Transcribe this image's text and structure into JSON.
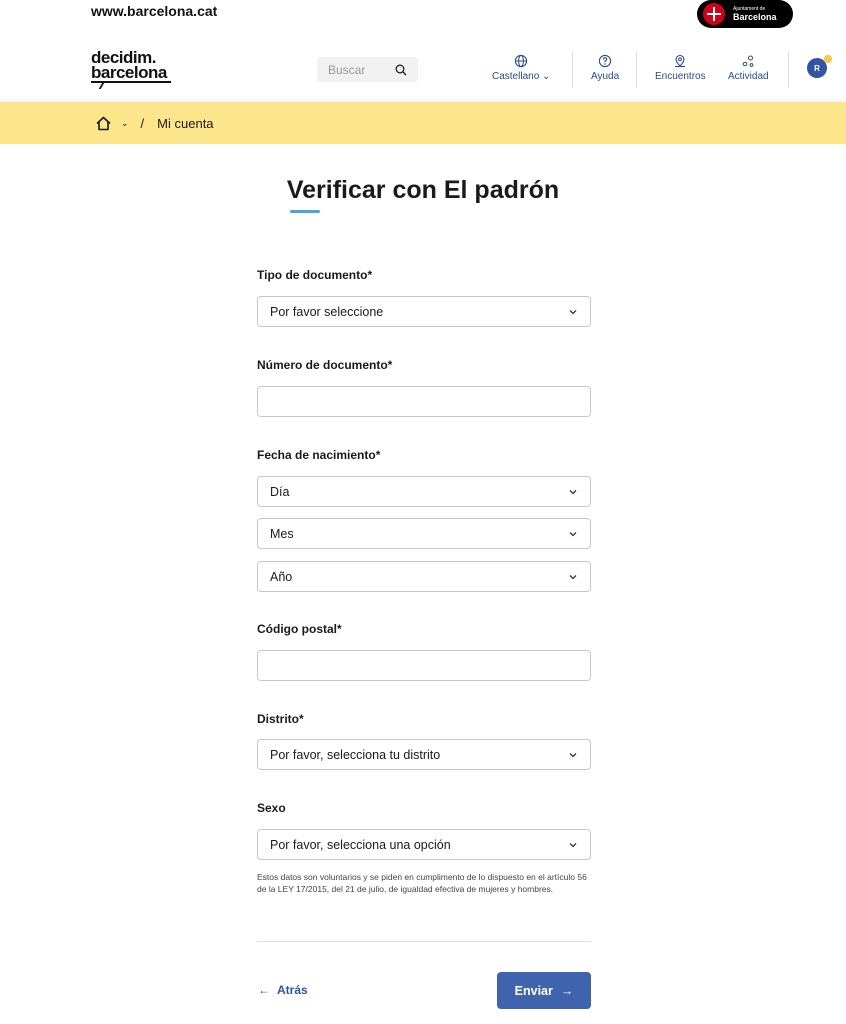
{
  "topbar": {
    "site_url": "www.barcelona.cat",
    "ajuntament_small": "Ajuntament de",
    "ajuntament_big": "Barcelona"
  },
  "header": {
    "brand_line1": "decidim.",
    "brand_line2": "barcelona",
    "search_placeholder": "Buscar",
    "language_label": "Castellano",
    "help_label": "Ayuda",
    "meetings_label": "Encuentros",
    "activity_label": "Actividad",
    "avatar_initial": "R"
  },
  "breadcrumb": {
    "current": "Mi cuenta"
  },
  "page": {
    "title": "Verificar con El padrón"
  },
  "form": {
    "document_type": {
      "label": "Tipo de documento*",
      "value": "Por favor seleccione"
    },
    "document_number": {
      "label": "Número de documento*",
      "value": ""
    },
    "birth_date": {
      "label": "Fecha de nacimiento*",
      "day": "Día",
      "month": "Mes",
      "year": "Año"
    },
    "postal_code": {
      "label": "Código postal*",
      "value": ""
    },
    "district": {
      "label": "Distrito*",
      "value": "Por favor, selecciona tu distrito"
    },
    "gender": {
      "label": "Sexo",
      "value": "Por favor, selecciona una opción"
    },
    "help_text": "Estos datos son voluntarios y se piden en cumplimento de lo dispuesto en el artículo 56 de la LEY 17/2015, del 21 de julio, de igualdad efectiva de mujeres y hombres."
  },
  "actions": {
    "back_label": "Atrás",
    "submit_label": "Enviar"
  },
  "colors": {
    "breadcrumb_bg": "#fde58c",
    "primary": "#3f63ad",
    "accent": "#4ea3df"
  }
}
